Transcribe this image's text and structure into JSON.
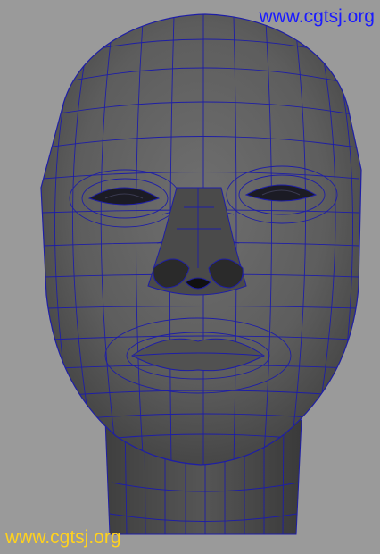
{
  "viewport": {
    "background": "#9a9a9a",
    "mesh_fill": "#5c5c5c",
    "wire_color": "#1e1ea6"
  },
  "subject": {
    "icon": "head-polygon-mesh-icon"
  },
  "watermarks": {
    "top": {
      "text": "www.cgtsj.org",
      "color": "#1a1aff"
    },
    "bottom": {
      "text": "www.cgtsj.org",
      "color": "#ffd21e"
    }
  }
}
